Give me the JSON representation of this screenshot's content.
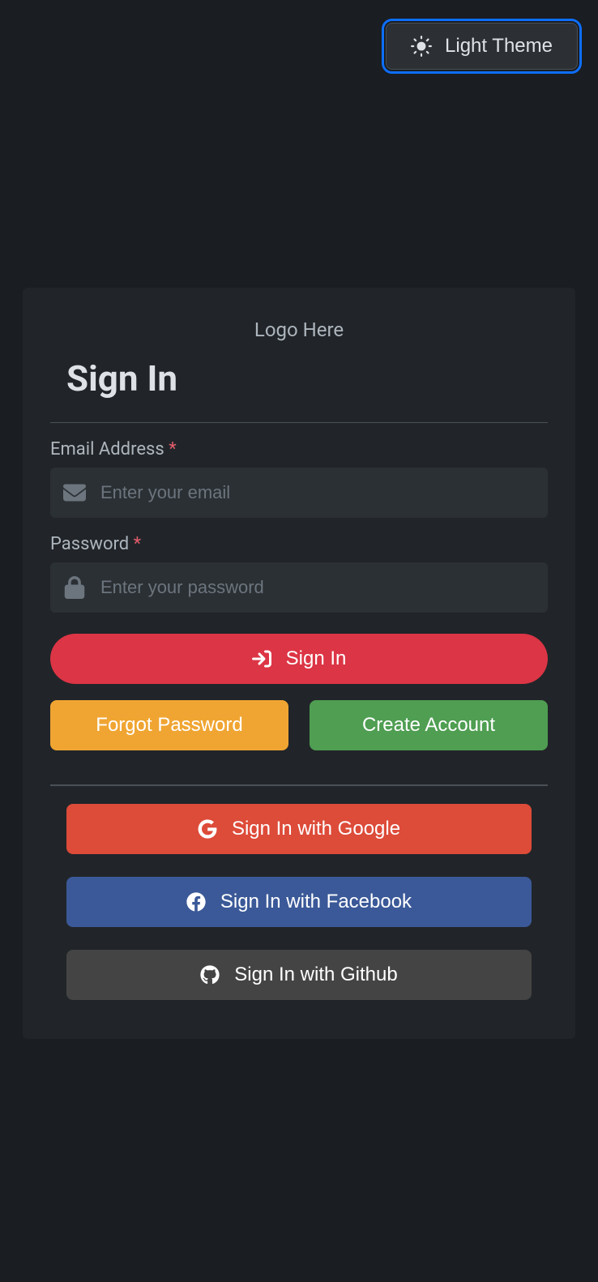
{
  "theme_toggle": {
    "label": "Light Theme"
  },
  "card": {
    "logo_text": "Logo Here",
    "title": "Sign In",
    "email": {
      "label": "Email Address",
      "placeholder": "Enter your email"
    },
    "password": {
      "label": "Password",
      "placeholder": "Enter your password"
    },
    "buttons": {
      "signin": "Sign In",
      "forgot": "Forgot Password",
      "create": "Create Account",
      "google": "Sign In with Google",
      "facebook": "Sign In with Facebook",
      "github": "Sign In with Github"
    },
    "required_marker": "*"
  }
}
